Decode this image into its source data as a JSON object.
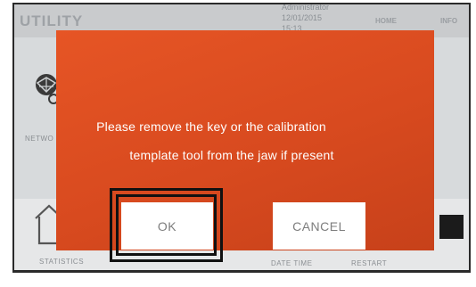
{
  "header": {
    "title": "UTILITY",
    "admin_label": "Administrator",
    "date": "12/01/2015",
    "time": "15:13",
    "nav_home": "HOME",
    "nav_info": "INFO"
  },
  "background": {
    "network_label": "NETWO",
    "statistics_label": "STATISTICS",
    "date_time_label": "DATE TIME",
    "restart_label": "RESTART"
  },
  "dialog": {
    "message_line1": "Please remove the key or the calibration",
    "message_line2": "template tool from the jaw if present",
    "ok_label": "OK",
    "cancel_label": "CANCEL"
  },
  "colors": {
    "dialog_background": "#dc4c20",
    "button_background": "#ffffff",
    "button_text": "#7d7d7d",
    "highlight_frame": "#111111"
  }
}
